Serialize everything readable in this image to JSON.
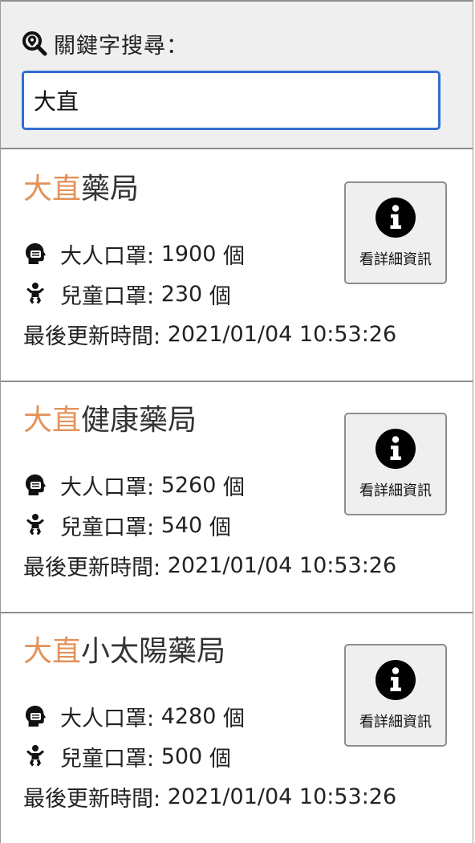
{
  "search": {
    "label": "關鍵字搜尋：",
    "value": "大直",
    "icon": "search-location-icon"
  },
  "labels": {
    "adult": "大人口罩:",
    "child": "兒童口罩:",
    "updated": "最後更新時間:",
    "unit": "個",
    "detail_button": "看詳細資訊"
  },
  "icons": {
    "adult": "adult-mask-icon",
    "child": "child-icon",
    "detail": "info-icon"
  },
  "colors": {
    "highlight": "#e3925a",
    "input_border": "#2f6fd0"
  },
  "pharmacies": [
    {
      "highlight": "大直",
      "name_rest": "藥局",
      "adult_count": "1900",
      "child_count": "230",
      "updated_at": "2021/01/04 10:53:26"
    },
    {
      "highlight": "大直",
      "name_rest": "健康藥局",
      "adult_count": "5260",
      "child_count": "540",
      "updated_at": "2021/01/04 10:53:26"
    },
    {
      "highlight": "大直",
      "name_rest": "小太陽藥局",
      "adult_count": "4280",
      "child_count": "500",
      "updated_at": "2021/01/04 10:53:26"
    }
  ]
}
